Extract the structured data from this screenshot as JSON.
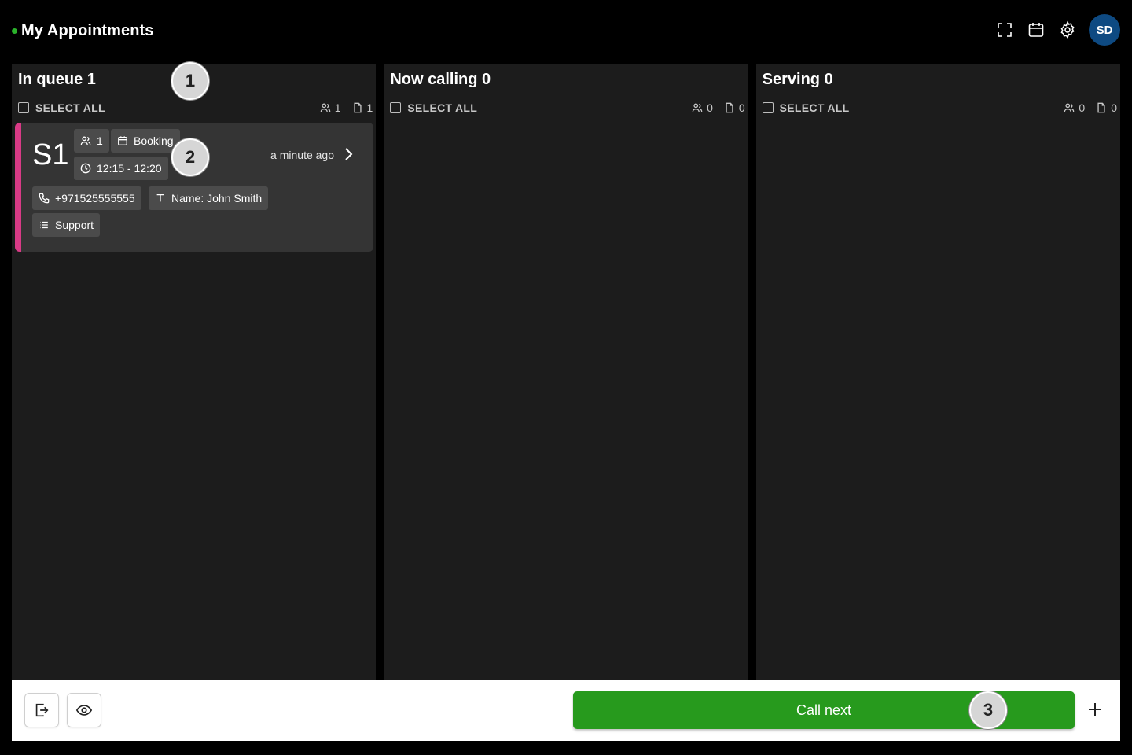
{
  "header": {
    "title": "My Appointments",
    "status_color": "#2bb32b",
    "icons": [
      "fullscreen-icon",
      "calendar-icon",
      "gear-icon"
    ],
    "avatar_initials": "SD",
    "avatar_color": "#0e4a82"
  },
  "columns": [
    {
      "title": "In queue 1",
      "select_all_label": "SELECT ALL",
      "people_count": "1",
      "doc_count": "1"
    },
    {
      "title": "Now calling 0",
      "select_all_label": "SELECT ALL",
      "people_count": "0",
      "doc_count": "0"
    },
    {
      "title": "Serving 0",
      "select_all_label": "SELECT ALL",
      "people_count": "0",
      "doc_count": "0"
    }
  ],
  "ticket": {
    "number": "S1",
    "accent_color": "#d93a86",
    "party_size": "1",
    "type": "Booking",
    "time_range": "12:15 - 12:20",
    "phone": "+971525555555",
    "name": "Name: John Smith",
    "service": "Support",
    "relative_time": "a minute ago"
  },
  "footer": {
    "call_next_label": "Call next",
    "call_next_color": "#279a1d"
  },
  "markers": [
    "1",
    "2",
    "3"
  ]
}
